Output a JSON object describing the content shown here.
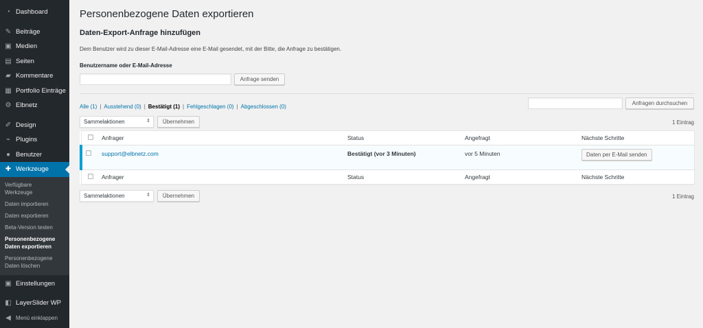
{
  "sidebar": {
    "items": [
      {
        "label": "Dashboard",
        "icon": "dashboard-icon"
      },
      {
        "label": "Beiträge",
        "icon": "pin-icon"
      },
      {
        "label": "Medien",
        "icon": "media-icon"
      },
      {
        "label": "Seiten",
        "icon": "page-icon"
      },
      {
        "label": "Kommentare",
        "icon": "comment-icon"
      },
      {
        "label": "Portfolio Einträge",
        "icon": "portfolio-icon"
      },
      {
        "label": "Elbnetz",
        "icon": "gear-icon"
      },
      {
        "label": "Design",
        "icon": "brush-icon"
      },
      {
        "label": "Plugins",
        "icon": "plugin-icon"
      },
      {
        "label": "Benutzer",
        "icon": "user-icon"
      },
      {
        "label": "Werkzeuge",
        "icon": "wrench-icon"
      }
    ],
    "submenu": [
      "Verfügbare Werkzeuge",
      "Daten importieren",
      "Daten exportieren",
      "Beta-Version testen",
      "Personenbezogene Daten exportieren",
      "Personenbezogene Daten löschen"
    ],
    "settings": "Einstellungen",
    "layerslider": "LayerSlider WP",
    "collapse": "Menü einklappen"
  },
  "page": {
    "title": "Personenbezogene Daten exportieren",
    "section_title": "Daten-Export-Anfrage hinzufügen",
    "description": "Dem Benutzer wird zu dieser E-Mail-Adresse eine E-Mail gesendet, mit der Bitte, die Anfrage zu bestätigen.",
    "field_label": "Benutzername oder E-Mail-Adresse",
    "field_value": "",
    "send_button": "Anfrage senden"
  },
  "filters": {
    "all": "Alle (1)",
    "pending": "Ausstehend (0)",
    "confirmed": "Bestätigt (1)",
    "failed": "Fehlgeschlagen (0)",
    "completed": "Abgeschlossen (0)",
    "separator": "|"
  },
  "search": {
    "value": "",
    "button": "Anfragen durchsuchen"
  },
  "bulk": {
    "selected": "Sammelaktionen",
    "apply": "Übernehmen",
    "count": "1 Eintrag"
  },
  "table": {
    "headers": [
      "Anfrager",
      "Status",
      "Angefragt",
      "Nächste Schritte"
    ],
    "row": {
      "email": "support@elbnetz.com",
      "status": "Bestätigt (vor 3 Minuten)",
      "requested": "vor 5 Minuten",
      "action": "Daten per E-Mail senden"
    }
  },
  "colors": {
    "accent": "#0073aa",
    "sidebar": "#23282d",
    "highlight": "#00a0d2"
  }
}
